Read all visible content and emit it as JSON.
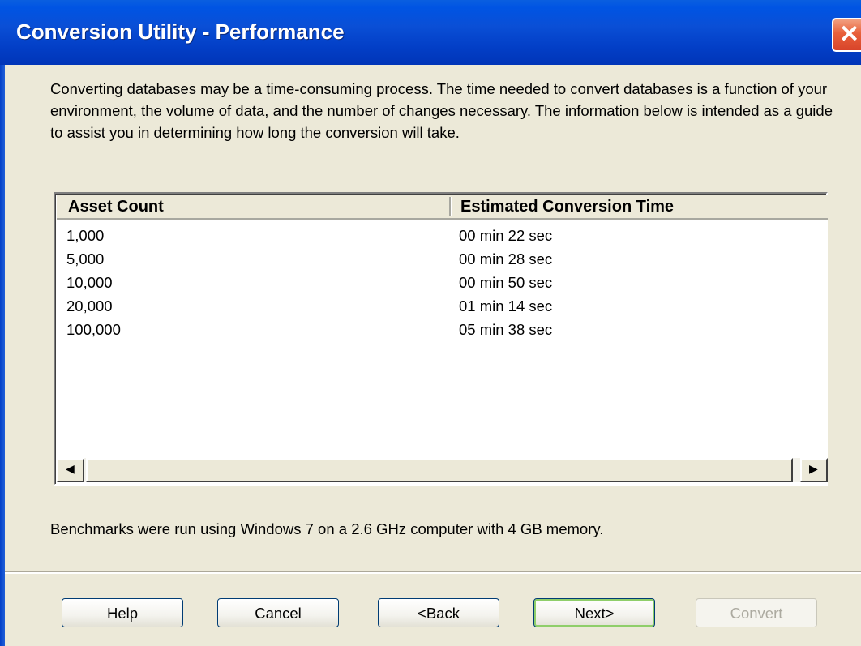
{
  "window": {
    "title": "Conversion Utility - Performance",
    "close_glyph": "✕"
  },
  "intro_text": "Converting databases may be a time-consuming process. The time needed to convert databases is a function of your environment, the volume of data, and the number of changes necessary. The information below is intended as a guide to assist you in determining how long the conversion will take.",
  "table": {
    "columns": [
      "Asset Count",
      "Estimated Conversion Time"
    ],
    "rows": [
      [
        "1,000",
        "00 min 22 sec"
      ],
      [
        "5,000",
        "00 min 28 sec"
      ],
      [
        "10,000",
        "00 min 50 sec"
      ],
      [
        "20,000",
        "01 min 14 sec"
      ],
      [
        "100,000",
        "05 min 38 sec"
      ]
    ]
  },
  "scrollbar": {
    "left_arrow": "◀",
    "right_arrow": "▶"
  },
  "benchmark_note": "Benchmarks were run using Windows 7 on a 2.6 GHz computer with 4 GB memory.",
  "buttons": {
    "help": "Help",
    "cancel": "Cancel",
    "back": "<Back",
    "next": "Next>",
    "convert": "Convert"
  },
  "colors": {
    "title_bar": "#0054e3",
    "close_button": "#e8603a",
    "default_button_highlight": "#8fce6a",
    "dialog_background": "#ece9d8"
  }
}
